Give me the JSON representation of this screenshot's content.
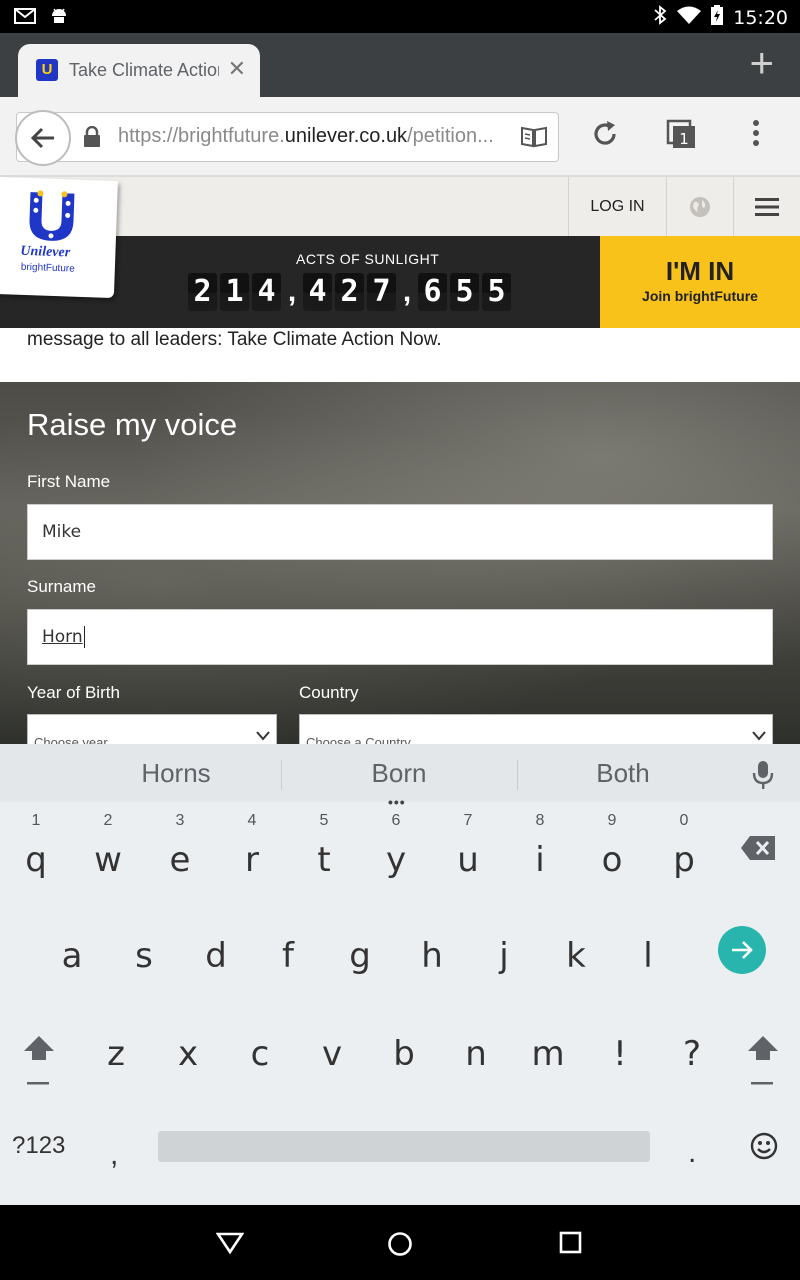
{
  "status_bar": {
    "time": "15:20",
    "icons": [
      "gmail-icon",
      "android-icon",
      "bluetooth-icon",
      "wifi-icon",
      "battery-charging-icon"
    ]
  },
  "browser": {
    "tab_title": "Take Climate Action Now",
    "url_prefix": "https://brightfuture.",
    "url_domain": "unilever.co.uk",
    "url_path": "/petition...",
    "tabs_count": "1"
  },
  "site": {
    "logo_brand": "Unilever",
    "logo_sub": "brightFuture",
    "login": "LOG IN",
    "counter_label": "ACTS OF SUNLIGHT",
    "counter_groups": [
      [
        "2",
        "1",
        "4"
      ],
      [
        "4",
        "2",
        "7"
      ],
      [
        "6",
        "5",
        "5"
      ]
    ],
    "cta_big": "I'M IN",
    "cta_small": "Join brightFuture",
    "message": "message to all leaders: Take Climate Action Now."
  },
  "form": {
    "heading": "Raise my voice",
    "first_name_label": "First Name",
    "first_name_value": "Mike",
    "surname_label": "Surname",
    "surname_value": "Horn",
    "year_label": "Year of Birth",
    "year_placeholder": "Choose year",
    "country_label": "Country",
    "country_placeholder": "Choose a Country"
  },
  "keyboard": {
    "suggestions": [
      "Horns",
      "Born",
      "Both"
    ],
    "row1": [
      [
        "q",
        "1"
      ],
      [
        "w",
        "2"
      ],
      [
        "e",
        "3"
      ],
      [
        "r",
        "4"
      ],
      [
        "t",
        "5"
      ],
      [
        "y",
        "6"
      ],
      [
        "u",
        "7"
      ],
      [
        "i",
        "8"
      ],
      [
        "o",
        "9"
      ],
      [
        "p",
        "0"
      ]
    ],
    "row2": [
      "a",
      "s",
      "d",
      "f",
      "g",
      "h",
      "j",
      "k",
      "l"
    ],
    "row3": [
      "z",
      "x",
      "c",
      "v",
      "b",
      "n",
      "m",
      "!",
      "?"
    ],
    "symbols_key": "?123",
    "comma": ",",
    "period": "."
  }
}
